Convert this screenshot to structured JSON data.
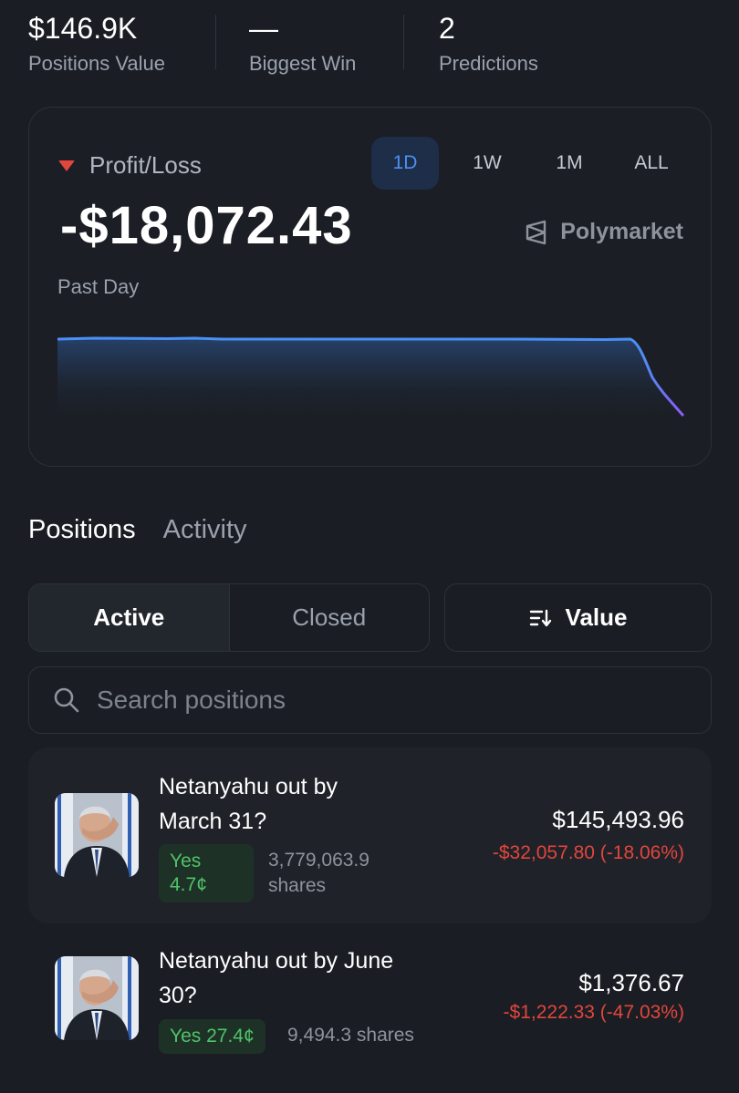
{
  "stats": [
    {
      "value": "$146.9K",
      "label": "Positions Value"
    },
    {
      "value": "—",
      "label": "Biggest Win"
    },
    {
      "value": "2",
      "label": "Predictions"
    }
  ],
  "pnl": {
    "label": "Profit/Loss",
    "value": "-$18,072.43",
    "period": "Past Day",
    "brand": "Polymarket",
    "ranges": [
      "1D",
      "1W",
      "1M",
      "ALL"
    ],
    "active_range": "1D",
    "trend": "down",
    "colors": {
      "line": "#4a90f5",
      "line_end": "#8b5cf6",
      "negative": "#e2463d"
    }
  },
  "tabs": {
    "positions": "Positions",
    "activity": "Activity",
    "active": "Positions"
  },
  "filters": {
    "active": "Active",
    "closed": "Closed",
    "sort": "Value"
  },
  "search": {
    "placeholder": "Search positions"
  },
  "positions": [
    {
      "title_line1": "Netanyahu out by",
      "title_line2": "March 31?",
      "outcome_line1": "Yes",
      "outcome_line2": "4.7¢",
      "shares_line1": "3,779,063.9",
      "shares_line2": "shares",
      "value": "$145,493.96",
      "pnl": "-$32,057.80 (-18.06%)"
    },
    {
      "title_line1": "Netanyahu out by June",
      "title_line2": "30?",
      "outcome": "Yes 27.4¢",
      "shares": "9,494.3 shares",
      "value": "$1,376.67",
      "pnl": "-$1,222.33 (-47.03%)"
    }
  ]
}
